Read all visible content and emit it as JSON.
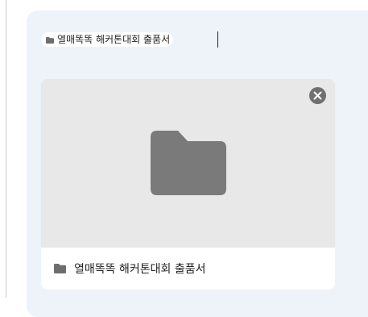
{
  "attachment_chip": {
    "icon": "folder-icon",
    "label": "열매똑똑 해커톤대회 출품서"
  },
  "file_card": {
    "preview_icon": "folder-icon",
    "remove_icon": "close-icon",
    "name": "열매똑똑 해커톤대회 출품서",
    "footer_icon": "folder-icon"
  },
  "colors": {
    "panel_background": "#eef2f9",
    "preview_background": "#e8e8e8",
    "folder_gray": "#7a7a7a",
    "remove_button_gray": "#707070",
    "text": "#222222"
  }
}
